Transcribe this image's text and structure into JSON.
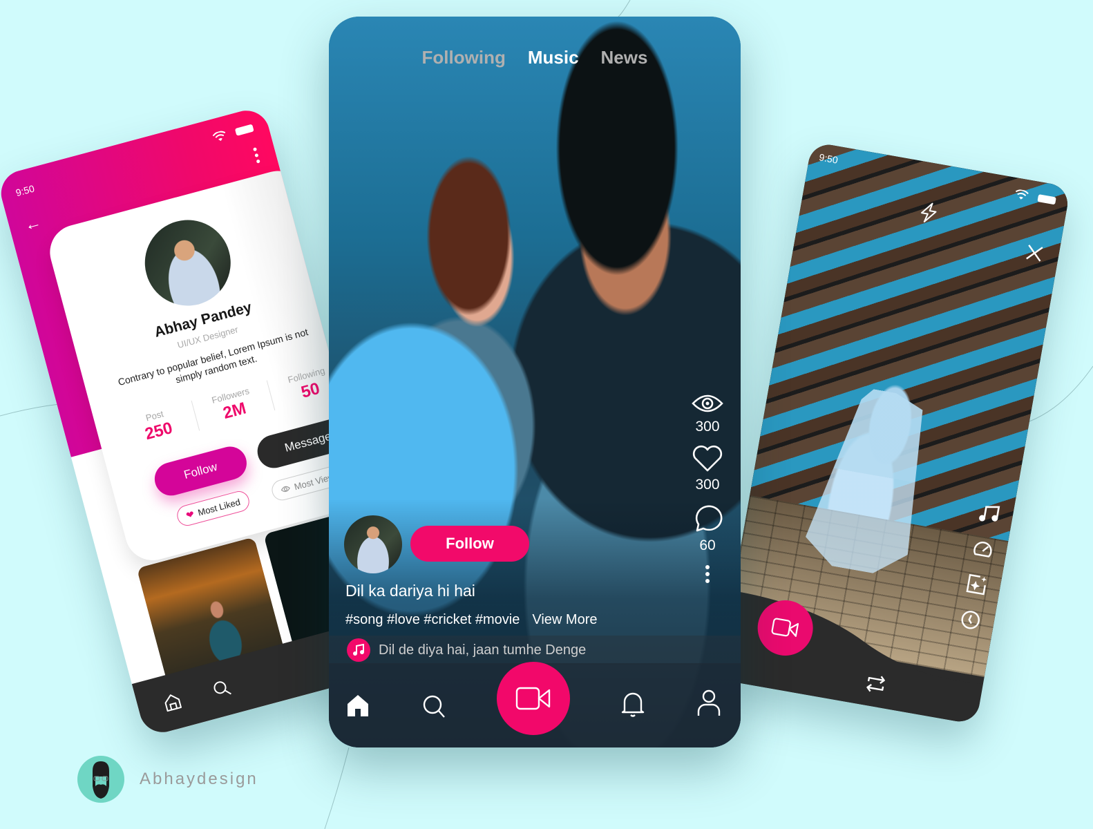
{
  "colors": {
    "background": "#d0fbfc",
    "accent_pink": "#f20a6a",
    "magenta": "#d40599",
    "dark": "#2b2b2b"
  },
  "profile_screen": {
    "status_time": "9:50",
    "name": "Abhay Pandey",
    "role": "UI/UX Designer",
    "bio": "Contrary to popular belief, Lorem Ipsum is not simply random text.",
    "stats": [
      {
        "label": "Post",
        "value": "250"
      },
      {
        "label": "Followers",
        "value": "2M"
      },
      {
        "label": "Following",
        "value": "50"
      }
    ],
    "follow_label": "Follow",
    "message_label": "Message",
    "chips": [
      {
        "label": "Most Liked",
        "icon": "heart-icon"
      },
      {
        "label": "Most Viewed",
        "icon": "eye-icon"
      }
    ],
    "nav_icons": [
      "home-icon",
      "search-icon"
    ],
    "fab_icon": "video-camera-icon"
  },
  "feed_screen": {
    "tabs": [
      {
        "label": "Following",
        "active": false
      },
      {
        "label": "Music",
        "active": true
      },
      {
        "label": "News",
        "active": false
      }
    ],
    "actions": [
      {
        "icon": "eye-icon",
        "count": "300"
      },
      {
        "icon": "heart-icon",
        "count": "300"
      },
      {
        "icon": "comment-icon",
        "count": "60"
      }
    ],
    "follow_label": "Follow",
    "video_title": "Dil ka dariya hi hai",
    "hashtags": "#song #love #cricket #movie",
    "view_more_label": "View More",
    "music_track": "Dil de diya hai, jaan tumhe Denge",
    "nav_icons": [
      "home-icon",
      "search-icon",
      "video-camera-icon",
      "bell-icon",
      "user-icon"
    ]
  },
  "camera_screen": {
    "status_time": "9:50",
    "top_icons": [
      "flash-icon",
      "close-icon"
    ],
    "tools": [
      "music-note-icon",
      "speed-gauge-icon",
      "effects-sparkle-icon",
      "timer-icon"
    ],
    "fab_icon": "video-camera-icon",
    "flip_icon": "flip-camera-icon"
  },
  "brand": {
    "name": "Abhaydesign"
  }
}
